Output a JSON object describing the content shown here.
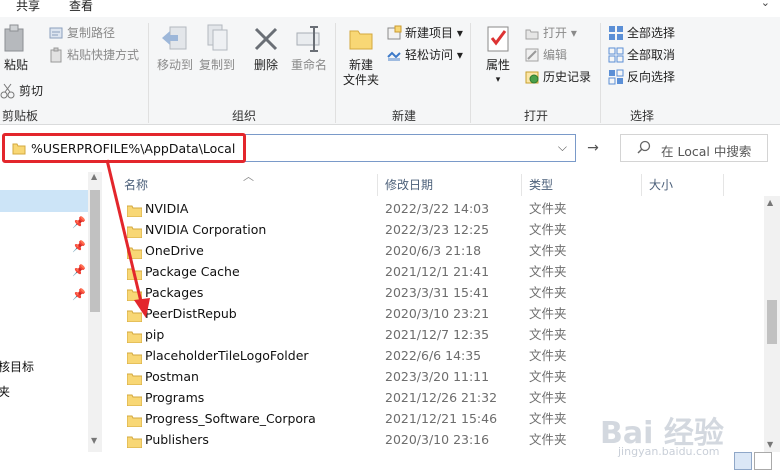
{
  "menubar": {
    "share_label": "共享",
    "view_label": "查看",
    "expand_label": "⌄"
  },
  "ribbon": {
    "clipboard": {
      "paste_label": "粘贴",
      "cut_label": "剪切",
      "copy_path_label": "复制路径",
      "paste_shortcut_label": "粘贴快捷方式",
      "group_label": "剪贴板"
    },
    "organize": {
      "move_to_label": "移动到",
      "copy_to_label": "复制到",
      "delete_label": "删除",
      "rename_label": "重命名",
      "group_label": "组织"
    },
    "new": {
      "new_folder_label": "新建\n文件夹",
      "new_folder_line1": "新建",
      "new_folder_line2": "文件夹",
      "new_item_label": "新建项目",
      "easy_access_label": "轻松访问",
      "group_label": "新建"
    },
    "open": {
      "properties_label": "属性",
      "open_label": "打开",
      "edit_label": "编辑",
      "history_label": "历史记录",
      "group_label": "打开"
    },
    "select": {
      "select_all_label": "全部选择",
      "select_none_label": "全部取消",
      "invert_label": "反向选择",
      "group_label": "选择"
    }
  },
  "address": {
    "path": "%USERPROFILE%\\AppData\\Local",
    "search_placeholder": "在 Local 中搜索"
  },
  "nav": {
    "items": [
      "核目标",
      "夹"
    ]
  },
  "list": {
    "columns": {
      "name": "名称",
      "date": "修改日期",
      "type": "类型",
      "size": "大小"
    },
    "rows": [
      {
        "name": "NVIDIA",
        "date": "2022/3/22 14:03",
        "type": "文件夹"
      },
      {
        "name": "NVIDIA Corporation",
        "date": "2022/3/23 12:25",
        "type": "文件夹"
      },
      {
        "name": "OneDrive",
        "date": "2020/6/3 21:18",
        "type": "文件夹"
      },
      {
        "name": "Package Cache",
        "date": "2021/12/1 21:41",
        "type": "文件夹"
      },
      {
        "name": "Packages",
        "date": "2023/3/31 15:41",
        "type": "文件夹"
      },
      {
        "name": "PeerDistRepub",
        "date": "2020/3/10 23:21",
        "type": "文件夹"
      },
      {
        "name": "pip",
        "date": "2021/12/7 12:35",
        "type": "文件夹"
      },
      {
        "name": "PlaceholderTileLogoFolder",
        "date": "2022/6/6 14:35",
        "type": "文件夹"
      },
      {
        "name": "Postman",
        "date": "2023/3/20 11:11",
        "type": "文件夹"
      },
      {
        "name": "Programs",
        "date": "2021/12/26 21:32",
        "type": "文件夹"
      },
      {
        "name": "Progress_Software_Corpora",
        "date": "2021/12/21 15:46",
        "type": "文件夹"
      },
      {
        "name": "Publishers",
        "date": "2020/3/10 23:16",
        "type": "文件夹"
      }
    ]
  },
  "watermark": {
    "text": "Bai 经验",
    "sub": "jingyan.baidu.com"
  },
  "colors": {
    "accent": "#0078d7",
    "highlight": "#e3262c",
    "folder": "#f8d775",
    "selection": "#cce4f7"
  }
}
